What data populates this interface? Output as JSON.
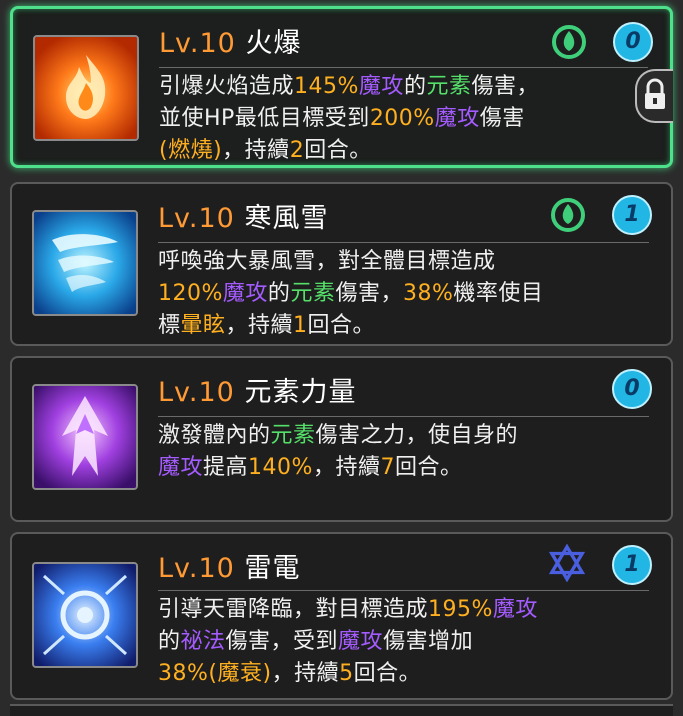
{
  "skills": [
    {
      "level": "Lv.10",
      "name": "火爆",
      "count": "0",
      "element_icon": "leaf-water-icon",
      "lines": [
        [
          {
            "t": "引爆火焰造成",
            "c": ""
          },
          {
            "t": "145%",
            "c": "orange"
          },
          {
            "t": "魔攻",
            "c": "purple"
          },
          {
            "t": "的",
            "c": ""
          },
          {
            "t": "元素",
            "c": "green"
          },
          {
            "t": "傷害，",
            "c": ""
          }
        ],
        [
          {
            "t": "並使HP最低目標受到",
            "c": ""
          },
          {
            "t": "200%",
            "c": "orange"
          },
          {
            "t": "魔攻",
            "c": "purple"
          },
          {
            "t": "傷害",
            "c": ""
          }
        ],
        [
          {
            "t": "(燃燒)",
            "c": "orange"
          },
          {
            "t": "，持續",
            "c": ""
          },
          {
            "t": "2",
            "c": "orange"
          },
          {
            "t": "回合。",
            "c": ""
          }
        ]
      ]
    },
    {
      "level": "Lv.10",
      "name": "寒風雪",
      "count": "1",
      "element_icon": "leaf-water-icon",
      "lines": [
        [
          {
            "t": "呼喚強大暴風雪，對全體目標造成",
            "c": ""
          }
        ],
        [
          {
            "t": "120%",
            "c": "orange"
          },
          {
            "t": "魔攻",
            "c": "purple"
          },
          {
            "t": "的",
            "c": ""
          },
          {
            "t": "元素",
            "c": "green"
          },
          {
            "t": "傷害，",
            "c": ""
          },
          {
            "t": "38%",
            "c": "orange"
          },
          {
            "t": "機率使目",
            "c": ""
          }
        ],
        [
          {
            "t": "標",
            "c": ""
          },
          {
            "t": "暈眩",
            "c": "orange"
          },
          {
            "t": "，持續",
            "c": ""
          },
          {
            "t": "1",
            "c": "orange"
          },
          {
            "t": "回合。",
            "c": ""
          }
        ]
      ]
    },
    {
      "level": "Lv.10",
      "name": "元素力量",
      "count": "0",
      "element_icon": "",
      "lines": [
        [
          {
            "t": "激發體內的",
            "c": ""
          },
          {
            "t": "元素",
            "c": "green"
          },
          {
            "t": "傷害之力，使自身的",
            "c": ""
          }
        ],
        [
          {
            "t": "魔攻",
            "c": "purple"
          },
          {
            "t": "提高",
            "c": ""
          },
          {
            "t": "140%",
            "c": "orange"
          },
          {
            "t": "，持續",
            "c": ""
          },
          {
            "t": "7",
            "c": "orange"
          },
          {
            "t": "回合。",
            "c": ""
          }
        ]
      ]
    },
    {
      "level": "Lv.10",
      "name": "雷電",
      "count": "1",
      "element_icon": "hexagram-icon",
      "lines": [
        [
          {
            "t": "引導天雷降臨，對目標造成",
            "c": ""
          },
          {
            "t": "195%",
            "c": "orange"
          },
          {
            "t": "魔攻",
            "c": "purple"
          }
        ],
        [
          {
            "t": "的",
            "c": ""
          },
          {
            "t": "祕法",
            "c": "purple"
          },
          {
            "t": "傷害，受到",
            "c": ""
          },
          {
            "t": "魔攻",
            "c": "purple"
          },
          {
            "t": "傷害增加",
            "c": ""
          }
        ],
        [
          {
            "t": "38%",
            "c": "orange"
          },
          {
            "t": "(魔衰)",
            "c": "orange"
          },
          {
            "t": "，持續",
            "c": ""
          },
          {
            "t": "5",
            "c": "orange"
          },
          {
            "t": "回合。",
            "c": ""
          }
        ]
      ]
    }
  ]
}
